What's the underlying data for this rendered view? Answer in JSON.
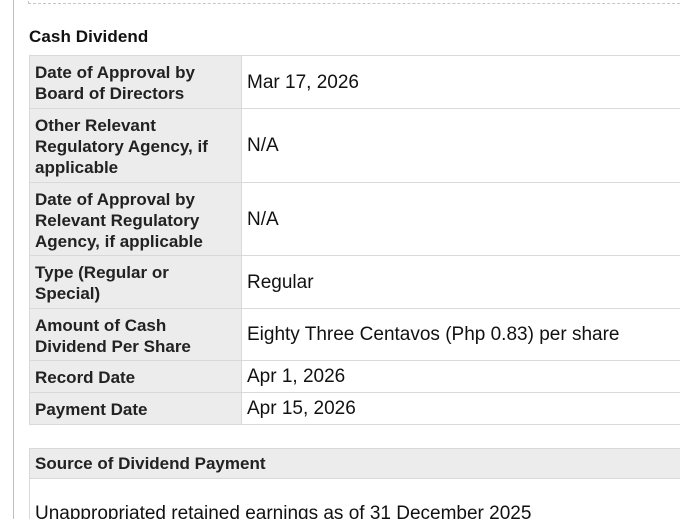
{
  "section": {
    "title": "Cash Dividend"
  },
  "details": {
    "rows": [
      {
        "label": "Date of Approval by Board of Directors",
        "value": "Mar 17, 2026"
      },
      {
        "label": "Other Relevant Regulatory Agency, if applicable",
        "value": "N/A"
      },
      {
        "label": "Date of Approval by Relevant Regulatory Agency, if applicable",
        "value": "N/A"
      },
      {
        "label": "Type (Regular or Special)",
        "value": "Regular"
      },
      {
        "label": "Amount of Cash Dividend Per Share",
        "value": "Eighty Three Centavos (Php 0.83) per share"
      },
      {
        "label": "Record Date",
        "value": "Apr 1, 2026"
      },
      {
        "label": "Payment Date",
        "value": "Apr 15, 2026"
      }
    ]
  },
  "source": {
    "header": "Source of Dividend Payment",
    "text": "Unappropriated retained earnings as of 31 December 2025"
  }
}
